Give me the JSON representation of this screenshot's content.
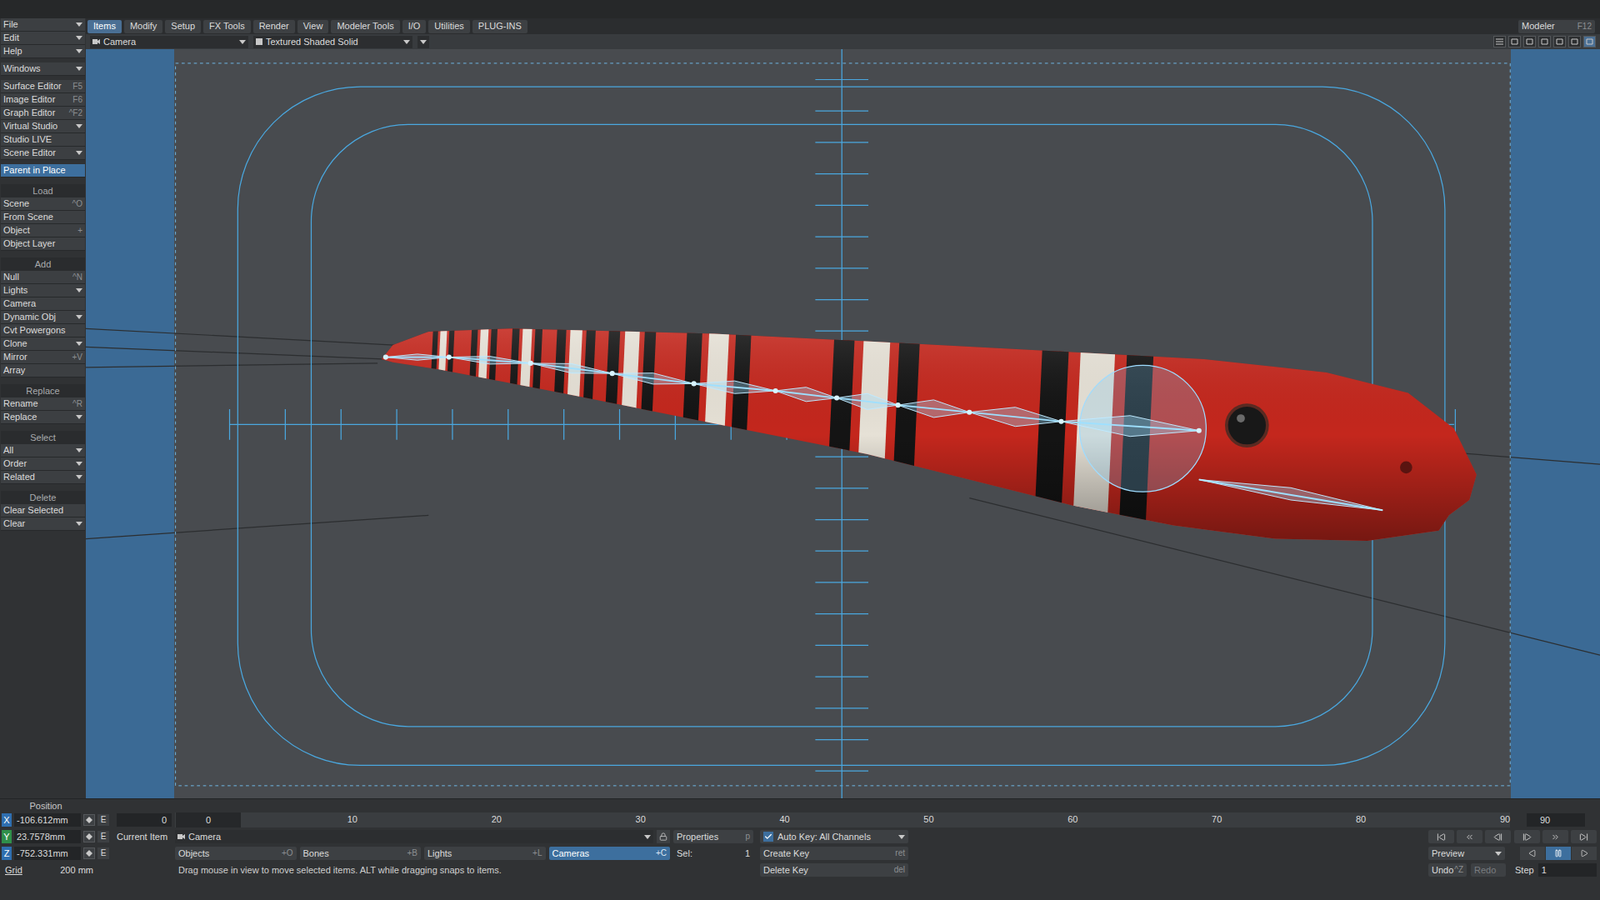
{
  "menu_tabs": [
    {
      "label": "Items",
      "selected": true
    },
    {
      "label": "Modify",
      "selected": false
    },
    {
      "label": "Setup",
      "selected": false
    },
    {
      "label": "FX Tools",
      "selected": false
    },
    {
      "label": "Render",
      "selected": false
    },
    {
      "label": "View",
      "selected": false
    },
    {
      "label": "Modeler Tools",
      "selected": false
    },
    {
      "label": "I/O",
      "selected": false
    },
    {
      "label": "Utilities",
      "selected": false
    },
    {
      "label": "PLUG-INS",
      "selected": false
    }
  ],
  "modeler_button": {
    "label": "Modeler",
    "shortcut": "F12"
  },
  "sidebar": [
    {
      "header": "",
      "items": [
        {
          "label": "File",
          "shortcut": "",
          "dropdown": true,
          "selected": false
        },
        {
          "label": "Edit",
          "shortcut": "",
          "dropdown": true,
          "selected": false
        },
        {
          "label": "Help",
          "shortcut": "",
          "dropdown": true,
          "selected": false
        }
      ]
    },
    {
      "header": "",
      "items": [
        {
          "label": "Windows",
          "shortcut": "",
          "dropdown": true,
          "selected": false
        }
      ]
    },
    {
      "header": "",
      "items": [
        {
          "label": "Surface Editor",
          "shortcut": "F5",
          "dropdown": false,
          "selected": false
        },
        {
          "label": "Image Editor",
          "shortcut": "F6",
          "dropdown": false,
          "selected": false
        },
        {
          "label": "Graph Editor",
          "shortcut": "^F2",
          "dropdown": false,
          "selected": false
        },
        {
          "label": "Virtual Studio",
          "shortcut": "",
          "dropdown": true,
          "selected": false
        },
        {
          "label": "Studio LIVE",
          "shortcut": "",
          "dropdown": false,
          "selected": false
        },
        {
          "label": "Scene Editor",
          "shortcut": "",
          "dropdown": true,
          "selected": false
        }
      ]
    },
    {
      "header": "",
      "items": [
        {
          "label": "Parent in Place",
          "shortcut": "",
          "dropdown": false,
          "selected": true
        }
      ]
    },
    {
      "header": "Load",
      "items": [
        {
          "label": "Scene",
          "shortcut": "^O",
          "dropdown": false,
          "selected": false
        },
        {
          "label": "From Scene",
          "shortcut": "",
          "dropdown": false,
          "selected": false
        },
        {
          "label": "Object",
          "shortcut": "+",
          "dropdown": false,
          "selected": false
        },
        {
          "label": "Object Layer",
          "shortcut": "",
          "dropdown": false,
          "selected": false
        }
      ]
    },
    {
      "header": "Add",
      "items": [
        {
          "label": "Null",
          "shortcut": "^N",
          "dropdown": false,
          "selected": false
        },
        {
          "label": "Lights",
          "shortcut": "",
          "dropdown": true,
          "selected": false
        },
        {
          "label": "Camera",
          "shortcut": "",
          "dropdown": false,
          "selected": false
        },
        {
          "label": "Dynamic Obj",
          "shortcut": "",
          "dropdown": true,
          "selected": false
        },
        {
          "label": "Cvt Powergons",
          "shortcut": "",
          "dropdown": false,
          "selected": false
        },
        {
          "label": "Clone",
          "shortcut": "",
          "dropdown": true,
          "selected": false
        },
        {
          "label": "Mirror",
          "shortcut": "+V",
          "dropdown": false,
          "selected": false
        },
        {
          "label": "Array",
          "shortcut": "",
          "dropdown": false,
          "selected": false
        }
      ]
    },
    {
      "header": "Replace",
      "items": [
        {
          "label": "Rename",
          "shortcut": "^R",
          "dropdown": false,
          "selected": false
        },
        {
          "label": "Replace",
          "shortcut": "",
          "dropdown": true,
          "selected": false
        }
      ]
    },
    {
      "header": "Select",
      "items": [
        {
          "label": "All",
          "shortcut": "",
          "dropdown": true,
          "selected": false
        },
        {
          "label": "Order",
          "shortcut": "",
          "dropdown": true,
          "selected": false
        },
        {
          "label": "Related",
          "shortcut": "",
          "dropdown": true,
          "selected": false
        }
      ]
    },
    {
      "header": "Delete",
      "items": [
        {
          "label": "Clear Selected",
          "shortcut": "",
          "dropdown": false,
          "selected": false
        },
        {
          "label": "Clear",
          "shortcut": "",
          "dropdown": true,
          "selected": false
        }
      ]
    }
  ],
  "viewport": {
    "view": "Camera",
    "mode": "Textured Shaded Solid"
  },
  "position": {
    "label": "Position",
    "key_button": "E",
    "axes": [
      {
        "axis": "X",
        "value": "-106.612mm",
        "color": "#2f6fb0"
      },
      {
        "axis": "Y",
        "value": "23.7578mm",
        "color": "#2f8f4a"
      },
      {
        "axis": "Z",
        "value": "-752.331mm",
        "color": "#2f6fb0"
      }
    ],
    "grid": {
      "label": "Grid",
      "value": "200 mm"
    }
  },
  "timeline": {
    "start": "0",
    "current": "0",
    "end": "90",
    "ticks": [
      "10",
      "20",
      "30",
      "40",
      "50",
      "60",
      "70",
      "80",
      "90"
    ]
  },
  "current_item": {
    "label": "Current Item",
    "value": "Camera"
  },
  "properties": {
    "label": "Properties",
    "shortcut": "p"
  },
  "selection": {
    "label": "Sel:",
    "count": "1"
  },
  "item_types": [
    {
      "label": "Objects",
      "shortcut": "+O",
      "selected": false
    },
    {
      "label": "Bones",
      "shortcut": "+B",
      "selected": false
    },
    {
      "label": "Lights",
      "shortcut": "+L",
      "selected": false
    },
    {
      "label": "Cameras",
      "shortcut": "+C",
      "selected": true
    }
  ],
  "auto_key": {
    "label": "Auto Key: All Channels",
    "checked": true
  },
  "keys": [
    {
      "label": "Create Key",
      "shortcut": "ret"
    },
    {
      "label": "Delete Key",
      "shortcut": "del"
    }
  ],
  "status": "Drag mouse in view to move selected items. ALT while dragging snaps to items.",
  "playback": {
    "preview": "Preview",
    "paused": true
  },
  "undo": {
    "label": "Undo",
    "shortcut": "^Z",
    "disabled": false
  },
  "redo": {
    "label": "Redo",
    "disabled": true
  },
  "step": {
    "label": "Step",
    "value": "1"
  }
}
